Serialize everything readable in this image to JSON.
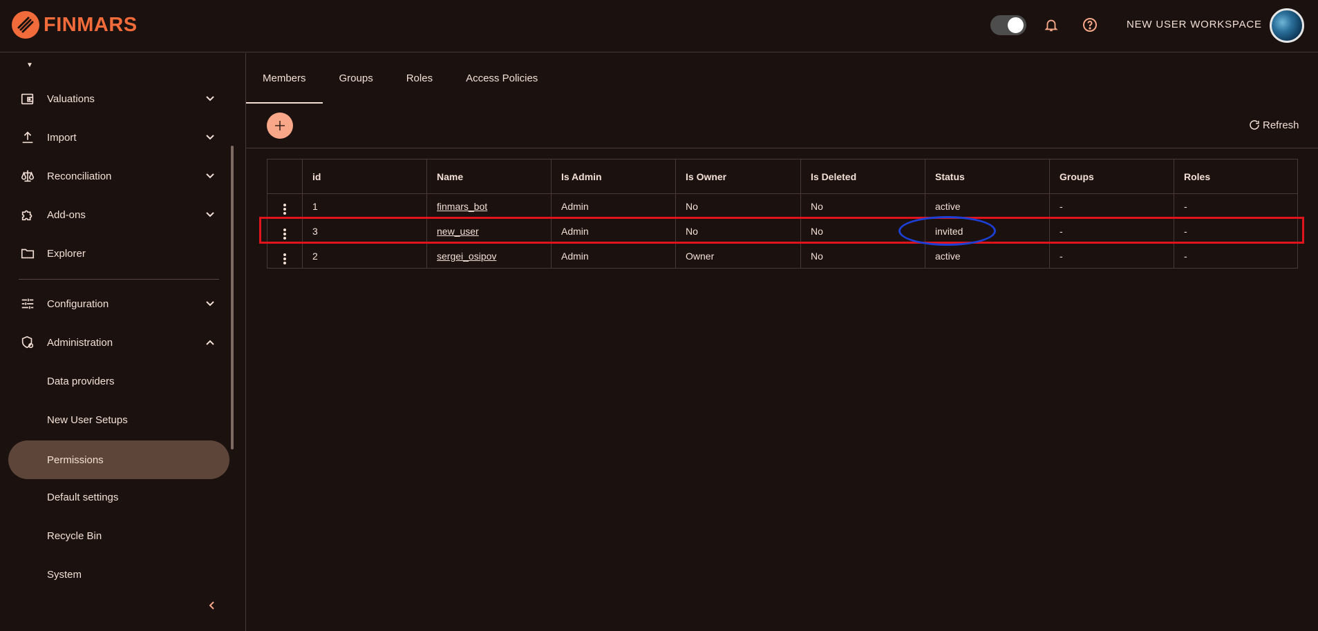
{
  "app": {
    "logo_text": "FINMARS",
    "workspace_name": "NEW USER WORKSPACE"
  },
  "colors": {
    "accent": "#f26b3a",
    "bg": "#1b1210",
    "text": "#f3dfd6",
    "active_nav": "#5e4539",
    "highlight_red": "#e0141c",
    "highlight_blue": "#1c3fd6"
  },
  "topbar": {
    "icons": [
      "theme-toggle",
      "bell-icon",
      "help-icon",
      "avatar"
    ]
  },
  "sidebar": {
    "items": [
      {
        "label": "Valuations",
        "icon": "wallet-icon",
        "expanded": false
      },
      {
        "label": "Import",
        "icon": "upload-icon",
        "expanded": false
      },
      {
        "label": "Reconciliation",
        "icon": "scale-icon",
        "expanded": false
      },
      {
        "label": "Add-ons",
        "icon": "puzzle-icon",
        "expanded": false
      },
      {
        "label": "Explorer",
        "icon": "folder-icon"
      },
      {
        "label": "Configuration",
        "icon": "sliders-icon",
        "expanded": false
      },
      {
        "label": "Administration",
        "icon": "shield-gear-icon",
        "expanded": true
      }
    ],
    "subitems": [
      {
        "label": "Data providers"
      },
      {
        "label": "New User Setups"
      },
      {
        "label": "Permissions",
        "active": true
      },
      {
        "label": "Default settings"
      },
      {
        "label": "Recycle Bin"
      },
      {
        "label": "System"
      }
    ]
  },
  "tabs": [
    {
      "label": "Members",
      "active": true
    },
    {
      "label": "Groups"
    },
    {
      "label": "Roles"
    },
    {
      "label": "Access Policies"
    }
  ],
  "toolbar": {
    "refresh_label": "Refresh"
  },
  "table": {
    "columns": [
      "",
      "id",
      "Name",
      "Is Admin",
      "Is Owner",
      "Is Deleted",
      "Status",
      "Groups",
      "Roles"
    ],
    "rows": [
      {
        "id": "1",
        "name": "finmars_bot",
        "is_admin": "Admin",
        "is_owner": "No",
        "is_deleted": "No",
        "status": "active",
        "groups": "-",
        "roles": "-"
      },
      {
        "id": "3",
        "name": "new_user",
        "is_admin": "Admin",
        "is_owner": "No",
        "is_deleted": "No",
        "status": "invited",
        "groups": "-",
        "roles": "-"
      },
      {
        "id": "2",
        "name": "sergei_osipov",
        "is_admin": "Admin",
        "is_owner": "Owner",
        "is_deleted": "No",
        "status": "active",
        "groups": "-",
        "roles": "-"
      }
    ]
  }
}
